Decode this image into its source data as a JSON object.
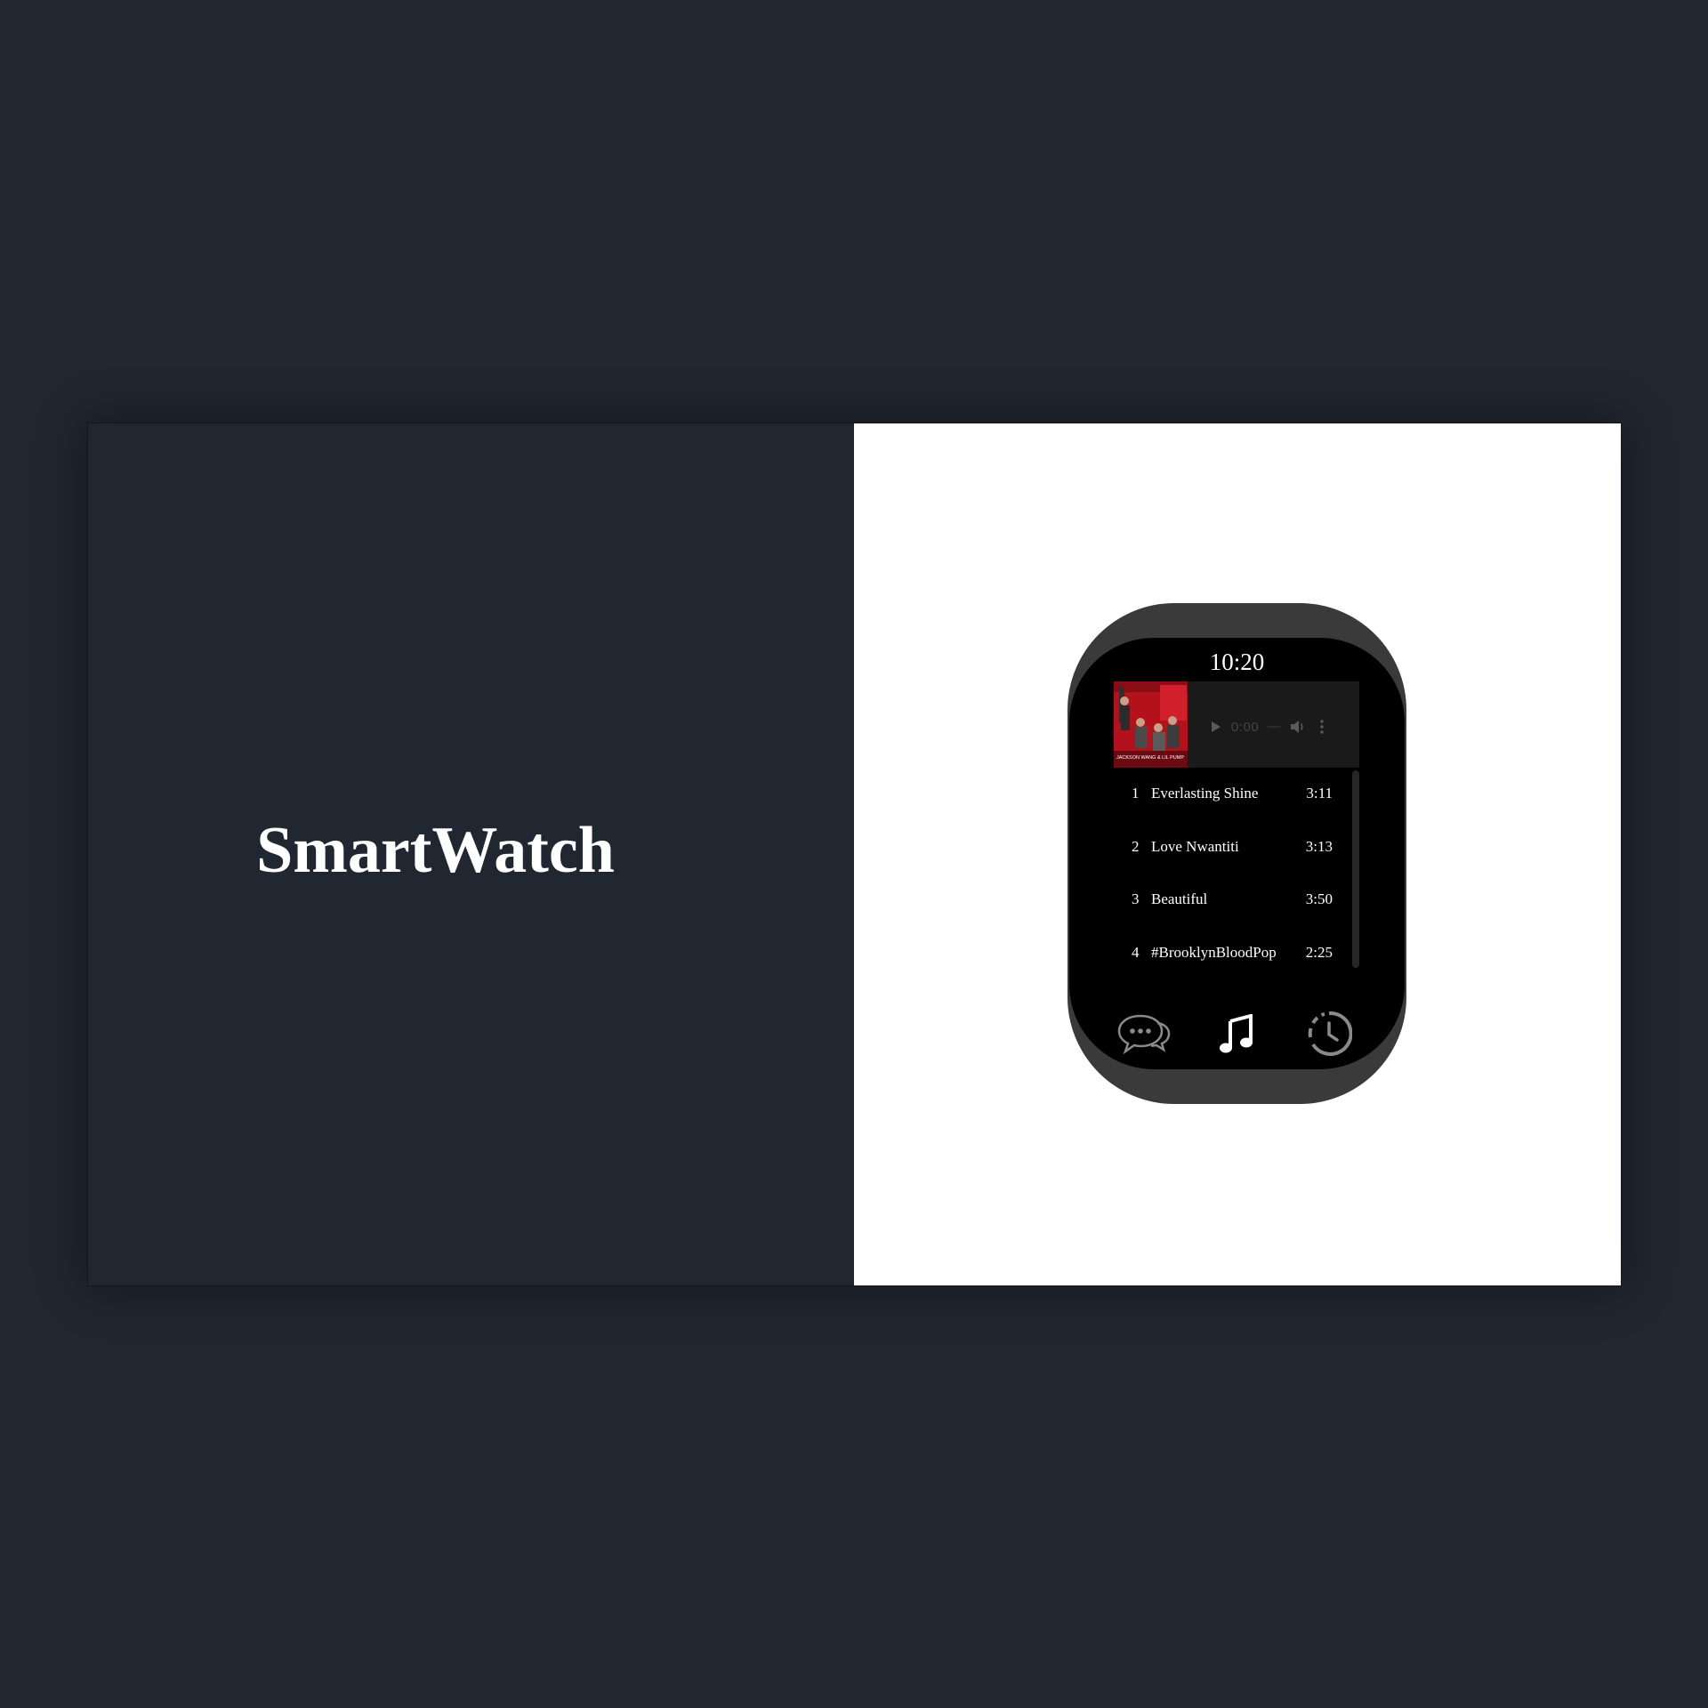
{
  "page": {
    "title": "SmartWatch"
  },
  "watch": {
    "time": "10:20",
    "player": {
      "current_time": "0:00",
      "album_art_caption": "JACKSON WANG & LIL PUMP"
    },
    "tracks": [
      {
        "number": "1",
        "title": "Everlasting Shine",
        "duration": "3:11"
      },
      {
        "number": "2",
        "title": "Love Nwantiti",
        "duration": "3:13"
      },
      {
        "number": "3",
        "title": "Beautiful",
        "duration": "3:50"
      },
      {
        "number": "4",
        "title": "#BrooklynBloodPop",
        "duration": "2:25"
      }
    ],
    "nav": {
      "icons": [
        "chat-icon",
        "music-note-icon",
        "clock-icon"
      ],
      "active": "music-note-icon"
    }
  },
  "colors": {
    "background": "#212730",
    "panel_right": "#ffffff",
    "watch_frame": "#3a3a3a",
    "watch_screen": "#000000",
    "text": "#ffffff",
    "inactive_icon": "#8a8a8a"
  }
}
